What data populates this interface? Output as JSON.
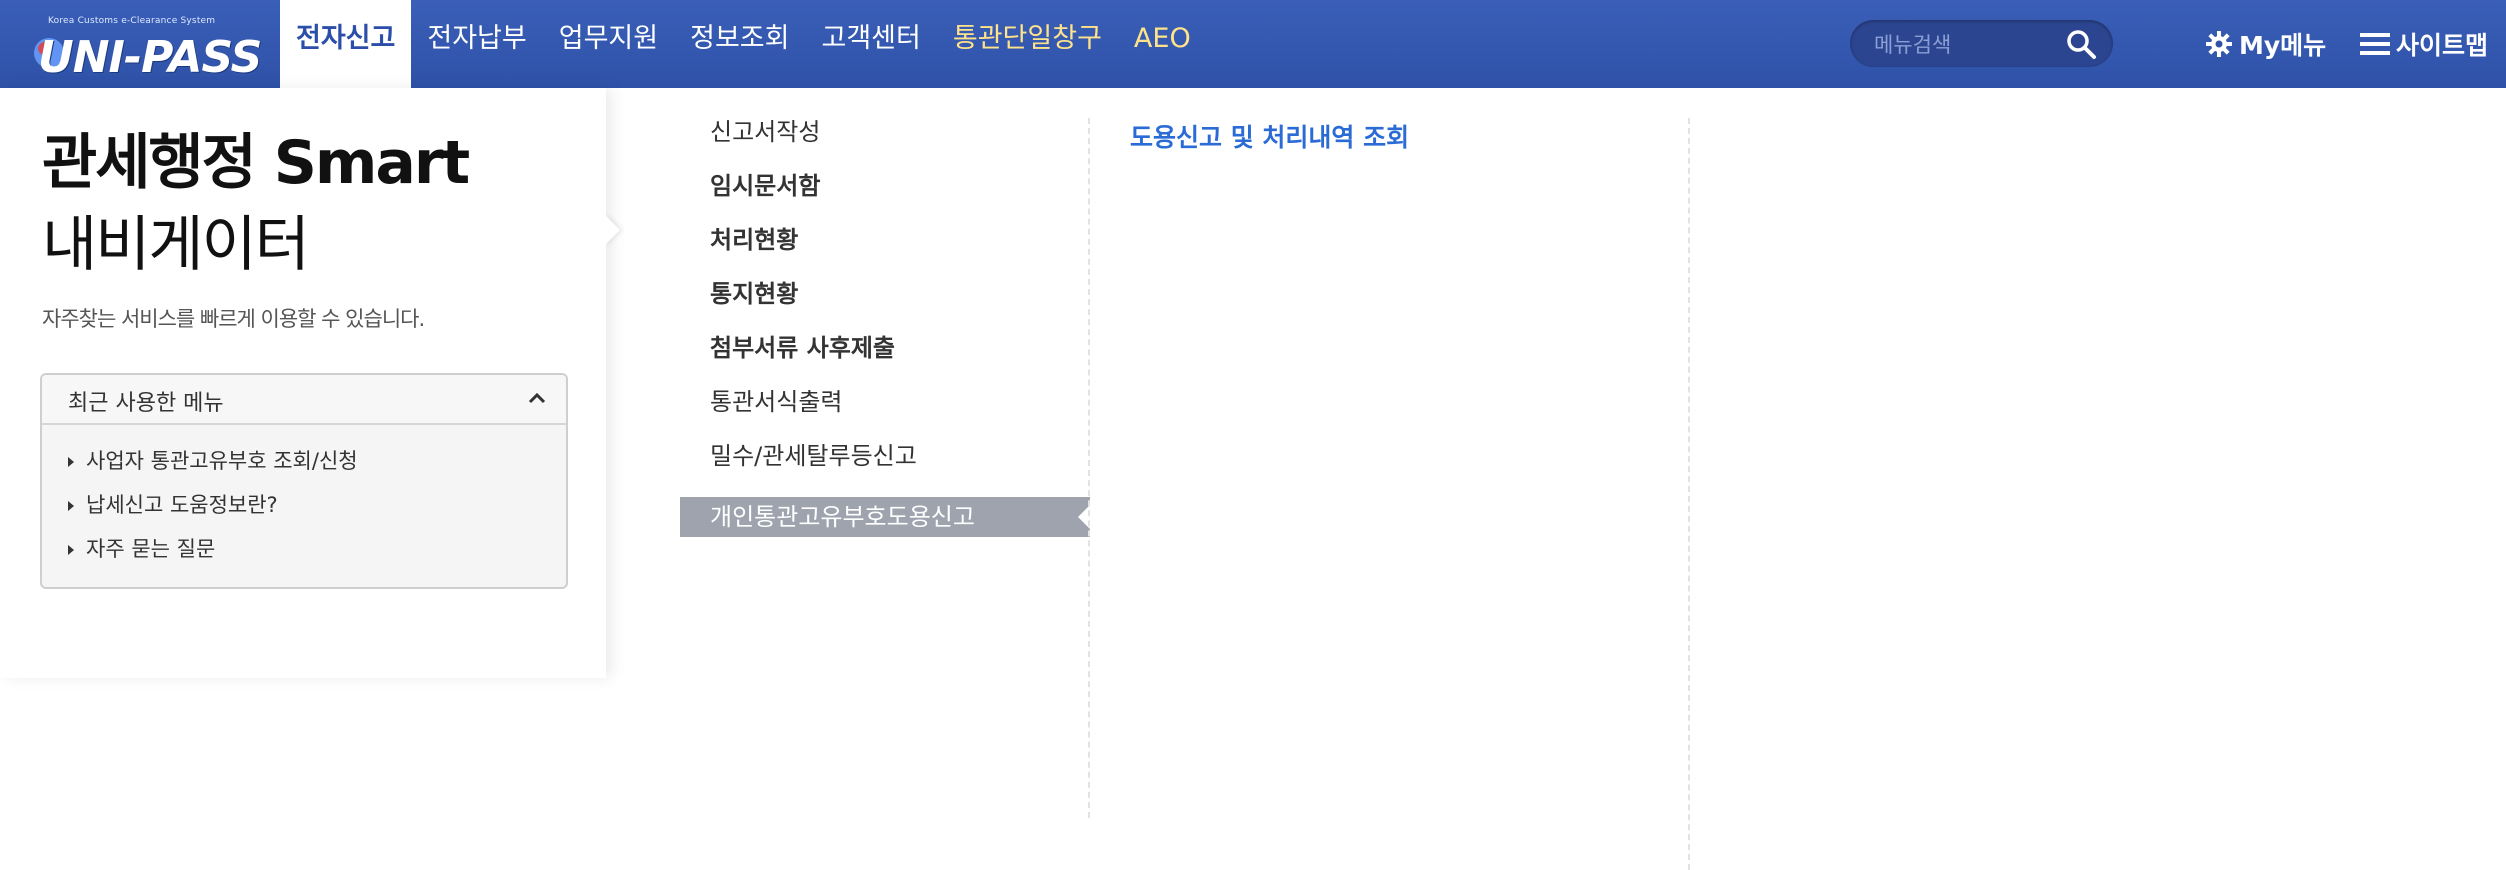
{
  "logo": {
    "tagline": "Korea Customs e-Clearance System",
    "text": "UNI-PASS"
  },
  "nav": {
    "items": [
      {
        "label": "전자신고"
      },
      {
        "label": "전자납부"
      },
      {
        "label": "업무지원"
      },
      {
        "label": "정보조회"
      },
      {
        "label": "고객센터"
      },
      {
        "label": "통관단일창구"
      },
      {
        "label": "AEO"
      }
    ]
  },
  "search": {
    "placeholder": "메뉴검색"
  },
  "tools": {
    "mymenu": "My메뉴",
    "sitemap": "사이트맵"
  },
  "left": {
    "title_line1": "관세행정 Smart",
    "title_line2": "내비게이터",
    "description": "자주찾는 서비스를 빠르게 이용할 수 있습니다.",
    "recent": {
      "header": "최근 사용한 메뉴",
      "items": [
        {
          "label": "사업자 통관고유부호 조회/신청"
        },
        {
          "label": "납세신고 도움정보란?"
        },
        {
          "label": "자주 묻는 질문"
        }
      ]
    }
  },
  "menu": {
    "items": [
      {
        "label": "신고서작성"
      },
      {
        "label": "임시문서함"
      },
      {
        "label": "처리현황"
      },
      {
        "label": "통지현황"
      },
      {
        "label": "첨부서류 사후제출"
      },
      {
        "label": "통관서식출력"
      },
      {
        "label": "밀수/관세탈루등신고"
      },
      {
        "label": "개인통관고유부호도용신고"
      }
    ]
  },
  "submenu": {
    "items": [
      {
        "label": "도용신고 및 처리내역 조회"
      }
    ]
  },
  "colors": {
    "nav_bg": "#2f52a8",
    "accent_blue": "#2b6bd6",
    "active_menu_bg": "#9ea3ae",
    "nav_yellow": "#ffe38a"
  }
}
